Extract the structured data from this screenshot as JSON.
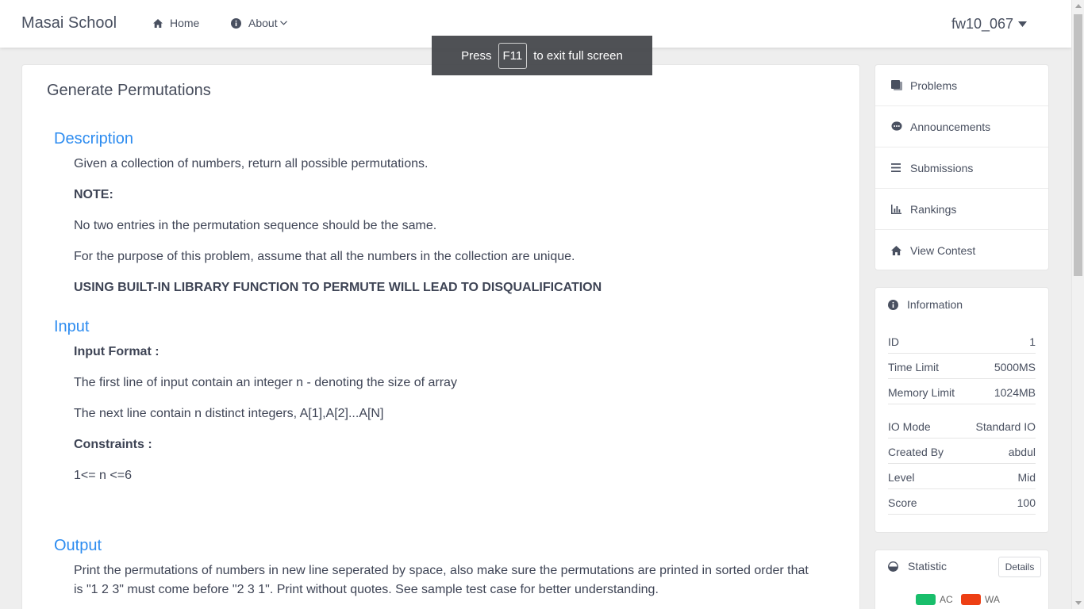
{
  "header": {
    "brand": "Masai School",
    "nav": {
      "home": "Home",
      "about": "About"
    },
    "user": "fw10_067"
  },
  "toast": {
    "prefix": "Press",
    "key": "F11",
    "suffix": "to exit full screen"
  },
  "problem": {
    "title": "Generate Permutations",
    "description_heading": "Description",
    "description": [
      "Given a collection of numbers, return all possible permutations.",
      "NOTE:",
      "No two entries in the permutation sequence should be the same.",
      "For the purpose of this problem, assume that all the numbers in the collection are unique.",
      "USING BUILT-IN LIBRARY FUNCTION TO PERMUTE WILL LEAD TO DISQUALIFICATION"
    ],
    "input_heading": "Input",
    "input": [
      "Input Format :",
      "The first line of input contain an integer n - denoting the size of array",
      "The next line contain n distinct integers, A[1],A[2]...A[N]",
      "Constraints :",
      "1<= n <=6"
    ],
    "output_heading": "Output",
    "output": "Print the permutations of numbers in new line seperated by space, also make sure the permutations are printed in sorted order that is \"1 2 3\" must come before \"2 3 1\". Print without quotes. See sample test case for better understanding."
  },
  "sidebar": {
    "menu": [
      {
        "label": "Problems",
        "icon": "book-icon"
      },
      {
        "label": "Announcements",
        "icon": "chat-icon"
      },
      {
        "label": "Submissions",
        "icon": "list-icon"
      },
      {
        "label": "Rankings",
        "icon": "bar-chart-icon"
      },
      {
        "label": "View Contest",
        "icon": "home-icon"
      }
    ],
    "information": {
      "heading": "Information",
      "rows": [
        {
          "label": "ID",
          "value": "1"
        },
        {
          "label": "Time Limit",
          "value": "5000MS"
        },
        {
          "label": "Memory Limit",
          "value": "1024MB"
        },
        {
          "label": "IO Mode",
          "value": "Standard IO"
        },
        {
          "label": "Created By",
          "value": "abdul"
        },
        {
          "label": "Level",
          "value": "Mid"
        },
        {
          "label": "Score",
          "value": "100"
        }
      ]
    },
    "statistic": {
      "heading": "Statistic",
      "details_label": "Details",
      "legend": [
        {
          "label": "AC",
          "color": "#19be6b"
        },
        {
          "label": "WA",
          "color": "#ed3f14"
        }
      ]
    }
  },
  "colors": {
    "accent": "#2d8cf0",
    "text": "#495060"
  }
}
